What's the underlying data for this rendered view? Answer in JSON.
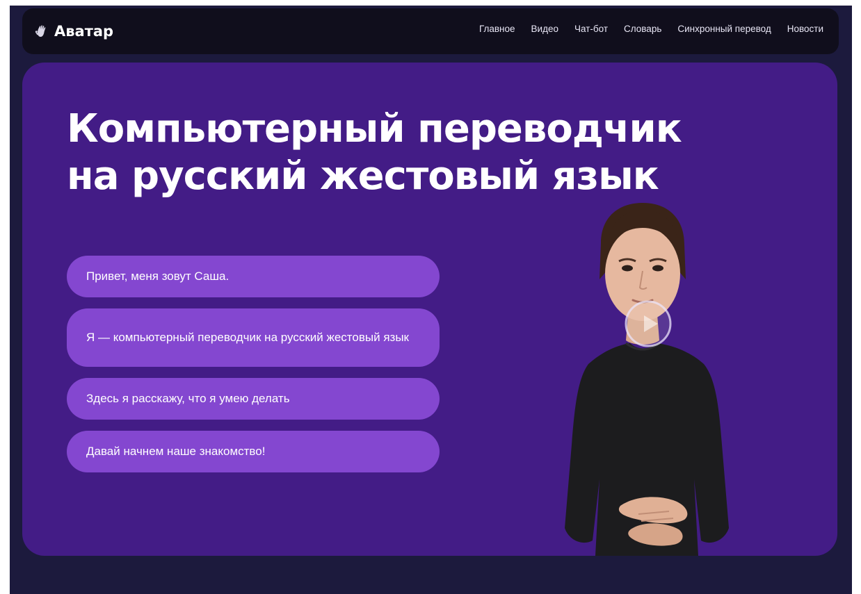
{
  "brand": {
    "name": "Аватар",
    "icon": "hand-logo-icon"
  },
  "nav": {
    "items": [
      {
        "label": "Главное"
      },
      {
        "label": "Видео"
      },
      {
        "label": "Чат-бот"
      },
      {
        "label": "Словарь"
      },
      {
        "label": "Синхронный перевод"
      },
      {
        "label": "Новости"
      }
    ]
  },
  "hero": {
    "title_line1": "Компьютерный переводчик",
    "title_line2": "на русский жестовый язык",
    "messages": [
      {
        "text": "Привет, меня зовут Саша."
      },
      {
        "text": "Я — компьютерный переводчик на русский жестовый язык"
      },
      {
        "text": "Здесь я расскажу, что я умею делать"
      },
      {
        "text": "Давай начнем наше знакомство!"
      }
    ]
  },
  "colors": {
    "page_bg": "#1c1a3d",
    "navbar_bg": "#100e1c",
    "hero_bg": "#431c86",
    "bubble_bg": "#8447d0",
    "text": "#ffffff"
  },
  "icons": {
    "play": "play-icon"
  }
}
